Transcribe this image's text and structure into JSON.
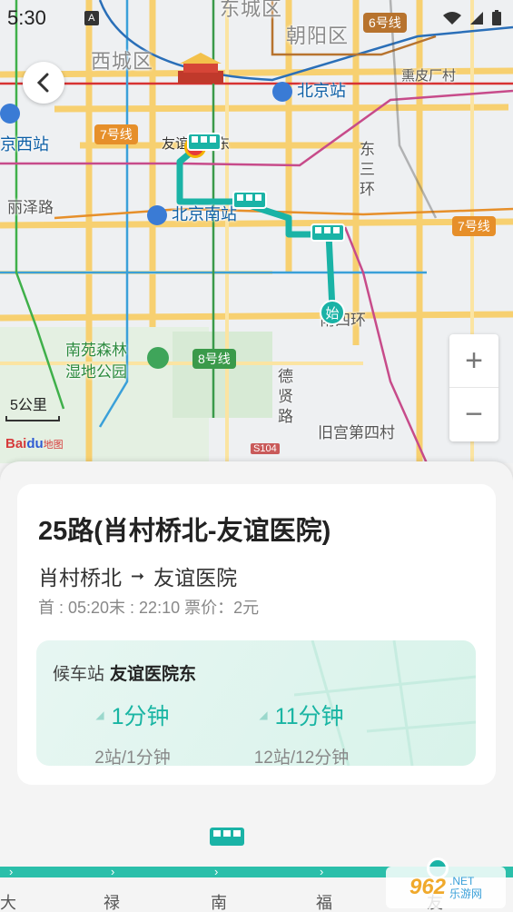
{
  "status_bar": {
    "time": "5:30",
    "notif_icon": "A"
  },
  "map": {
    "districts": [
      "东城区",
      "西城区",
      "朝阳区"
    ],
    "stations": [
      "北京站",
      "京西站",
      "北京南站"
    ],
    "roads": [
      "丽泽路",
      "东三环",
      "南四环",
      "德贤路",
      "旧宫第四村",
      "熏皮厂村"
    ],
    "park": "南苑森林\n湿地公园",
    "metro_lines": [
      {
        "label": "6号线",
        "color": "#b7732e"
      },
      {
        "label": "7号线",
        "color": "#e68f2a"
      },
      {
        "label": "7号线",
        "color": "#e68f2a"
      },
      {
        "label": "8号线",
        "color": "#3a9a4a"
      }
    ],
    "route_labels": {
      "end_stop": "友谊医院东",
      "start_marker": "始"
    },
    "route_color": "#1ab3a6",
    "scale_label": "5公里",
    "logo_text": "Bai",
    "logo_du": "du",
    "logo_sub": "地图",
    "road_code": "S104"
  },
  "zoom": {
    "in": "+",
    "out": "−"
  },
  "info": {
    "route_title": "25路(肖村桥北-友谊医院)",
    "from": "肖村桥北",
    "arrow": "➞",
    "to": "友谊医院",
    "schedule": "首 : 05:20末 : 22:10 票价：2元",
    "wait_prefix": "候车站",
    "wait_station": "友谊医院东",
    "arrivals": [
      {
        "minutes": "1分钟",
        "detail": "2站/1分钟"
      },
      {
        "minutes": "11分钟",
        "detail": "12站/12分钟"
      }
    ]
  },
  "bus_line": {
    "stops": [
      "大",
      "禄",
      "南",
      "福",
      "友"
    ],
    "accent": "#2bbfaa"
  },
  "watermark": {
    "main": "962",
    "net": ".NET",
    "cn": "乐游网"
  }
}
